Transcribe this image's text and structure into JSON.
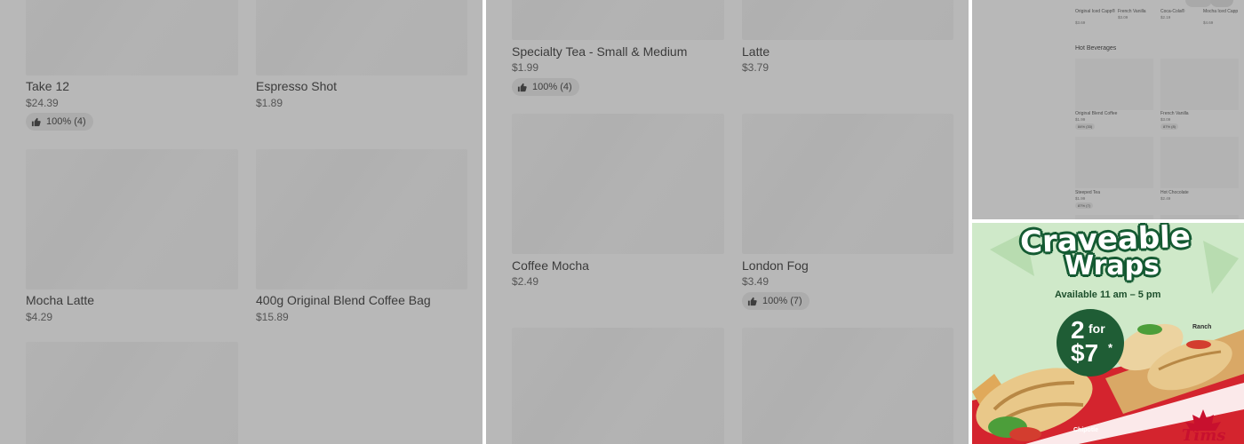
{
  "left_panel": {
    "items": [
      {
        "name": "Take 12",
        "price": "$24.39",
        "rating": "100% (4)"
      },
      {
        "name": "Espresso Shot",
        "price": "$1.89"
      },
      {
        "name": "Mocha Latte",
        "price": "$4.29"
      },
      {
        "name": "400g Original Blend Coffee Bag",
        "price": "$15.89"
      }
    ]
  },
  "mid_panel": {
    "items": [
      {
        "name": "Specialty Tea - Small & Medium",
        "price": "$1.99",
        "rating": "100% (4)"
      },
      {
        "name": "Latte",
        "price": "$3.79"
      },
      {
        "name": "Coffee Mocha",
        "price": "$2.49"
      },
      {
        "name": "London Fog",
        "price": "$3.49",
        "rating": "100% (7)"
      }
    ]
  },
  "mini_menu": {
    "top_items": [
      {
        "name": "Original Iced Capp®",
        "price": "$3.69"
      },
      {
        "name": "French Vanilla",
        "price": "$3.09"
      },
      {
        "name": "Coca-Cola®",
        "price": "$2.19"
      },
      {
        "name": "Mocha Iced Capp",
        "price": "$4.69"
      }
    ],
    "section_title": "Hot Beverages",
    "items": [
      {
        "name": "Original Blend Coffee",
        "price": "$1.99",
        "rating": "84% (33)"
      },
      {
        "name": "French Vanilla",
        "price": "$3.09",
        "rating": "87% (8)"
      },
      {
        "name": "Steeped Tea",
        "price": "$1.99",
        "rating": "87% (7)"
      },
      {
        "name": "Hot Chocolate",
        "price": "$2.49"
      }
    ]
  },
  "promo": {
    "title_line1": "Craveable",
    "title_line2": "Wraps",
    "availability": "Available 11 am – 5 pm",
    "deal_line1": "2",
    "deal_for": "for",
    "deal_line2": "$7",
    "deal_star": "*",
    "label_ranch": "Ranch",
    "label_chipotle": "Chipotle",
    "brand": "Tims"
  },
  "colors": {
    "overlay_gray": "#b8b8b8",
    "promo_bg": "#cfe9c9",
    "promo_dark_green": "#1f5d35",
    "promo_red": "#c8102e"
  }
}
